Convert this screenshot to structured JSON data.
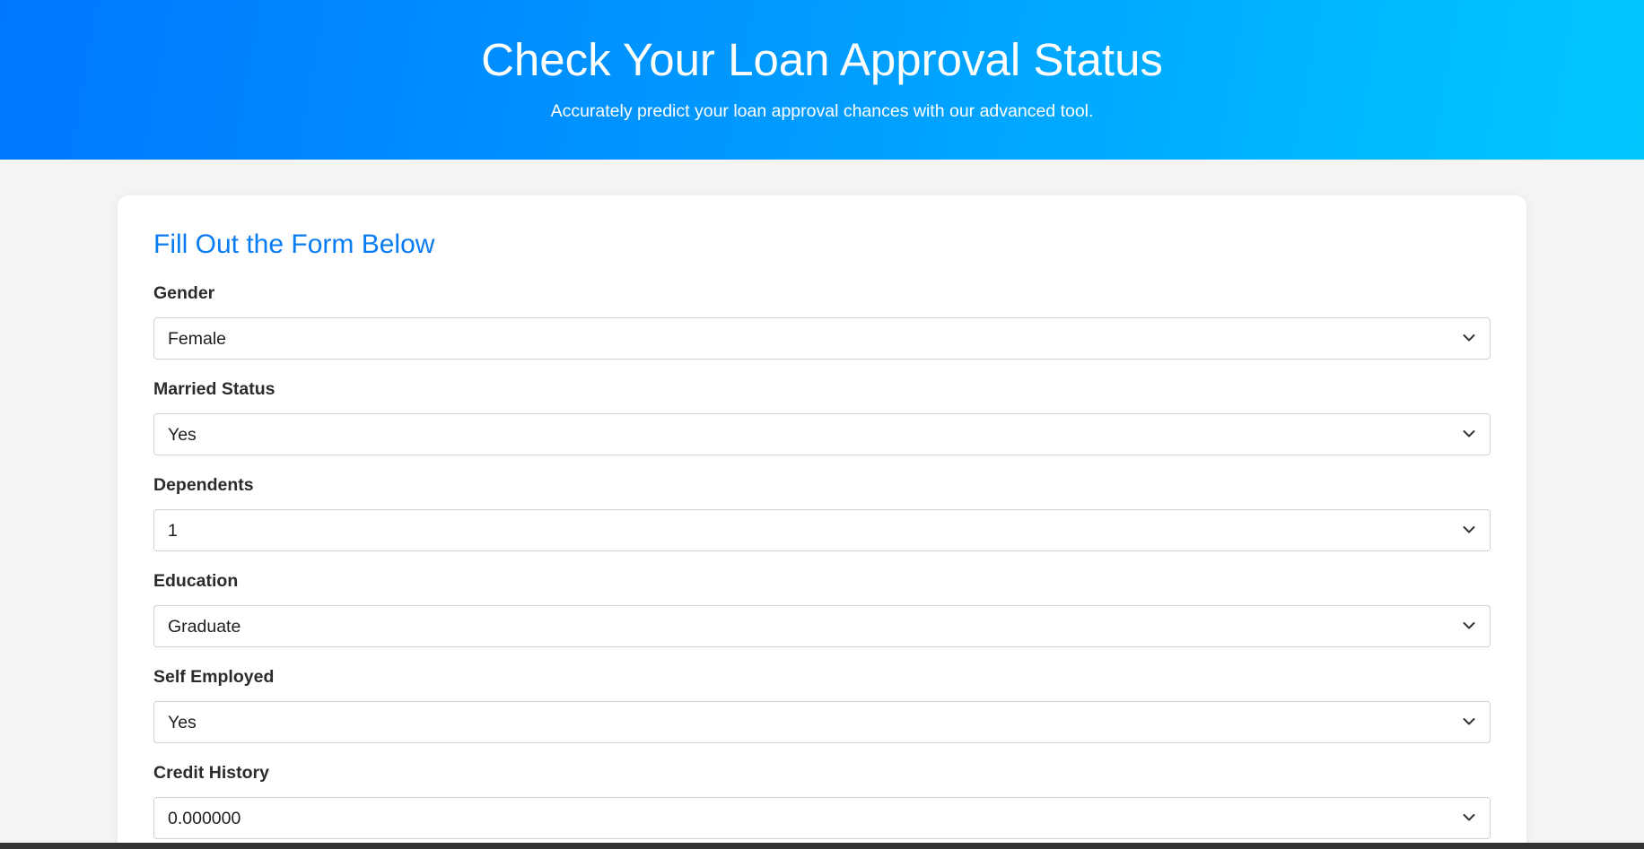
{
  "hero": {
    "title": "Check Your Loan Approval Status",
    "subtitle": "Accurately predict your loan approval chances with our advanced tool."
  },
  "form": {
    "heading": "Fill Out the Form Below",
    "fields": [
      {
        "label": "Gender",
        "value": "Female"
      },
      {
        "label": "Married Status",
        "value": "Yes"
      },
      {
        "label": "Dependents",
        "value": "1"
      },
      {
        "label": "Education",
        "value": "Graduate"
      },
      {
        "label": "Self Employed",
        "value": "Yes"
      },
      {
        "label": "Credit History",
        "value": "0.000000"
      }
    ]
  },
  "colors": {
    "gradient_start": "#0077ff",
    "gradient_end": "#00c8ff",
    "heading_blue": "#0a7cf2",
    "page_background": "#f4f4f4"
  },
  "icons": {
    "select_indicator": "chevron-down-icon"
  }
}
